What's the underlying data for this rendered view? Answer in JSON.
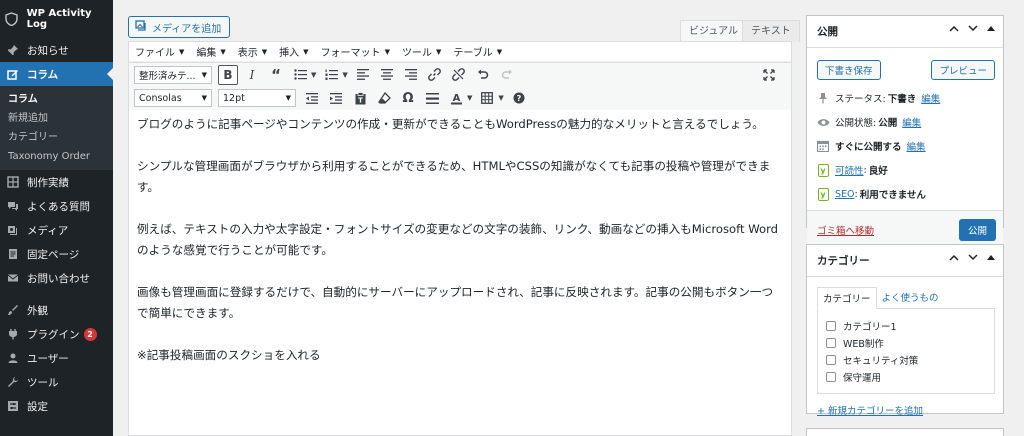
{
  "sidebar": {
    "site_title": "WP Activity Log",
    "items": [
      {
        "label": "お知らせ"
      },
      {
        "label": "コラム"
      },
      {
        "label": "制作実績"
      },
      {
        "label": "よくある質問"
      },
      {
        "label": "メディア"
      },
      {
        "label": "固定ページ"
      },
      {
        "label": "お問い合わせ"
      },
      {
        "label": "外観"
      },
      {
        "label": "プラグイン",
        "badge": "2"
      },
      {
        "label": "ユーザー"
      },
      {
        "label": "ツール"
      },
      {
        "label": "設定"
      }
    ],
    "submenu": [
      "コラム",
      "新規追加",
      "カテゴリー",
      "Taxonomy Order"
    ]
  },
  "editor": {
    "add_media": "メディアを追加",
    "tab_visual": "ビジュアル",
    "tab_text": "テキスト",
    "menus": [
      "ファイル",
      "編集",
      "表示",
      "挿入",
      "フォーマット",
      "ツール",
      "テーブル"
    ],
    "format_select": "整形済みテ...",
    "font_select": "Consolas",
    "size_select": "12pt",
    "paragraphs": [
      "ブログのように記事ページやコンテンツの作成・更新ができることもWordPressの魅力的なメリットと言えるでしょう。",
      "シンプルな管理画面がブラウザから利用することができるため、HTMLやCSSの知識がなくても記事の投稿や管理ができます。",
      "例えば、テキストの入力や太字設定・フォントサイズの変更などの文字の装飾、リンク、動画などの挿入もMicrosoft Wordのような感覚で行うことが可能です。",
      "画像も管理画面に登録するだけで、自動的にサーバーにアップロードされ、記事に反映されます。記事の公開もボタン一つで簡単にできます。",
      "※記事投稿画面のスクショを入れる"
    ]
  },
  "publish": {
    "title": "公開",
    "save_draft": "下書き保存",
    "preview": "プレビュー",
    "status_label": "ステータス:",
    "status_value": "下書き",
    "visibility_label": "公開状態:",
    "visibility_value": "公開",
    "schedule_label": "すぐに公開する",
    "edit": "編集",
    "readability_link": "可読性",
    "readability_value": "良好",
    "seo_link": "SEO",
    "seo_value": "利用できません",
    "trash": "ゴミ箱へ移動",
    "publish_btn": "公開"
  },
  "category": {
    "title": "カテゴリー",
    "tab_all": "カテゴリー",
    "tab_popular": "よく使うもの",
    "items": [
      "カテゴリー1",
      "WEB制作",
      "セキュリティ対策",
      "保守運用"
    ],
    "add_new": "+ 新規カテゴリーを追加"
  },
  "colors": {
    "accent": "#2271b1",
    "sidebar": "#1d2327",
    "danger": "#b32d2e"
  }
}
